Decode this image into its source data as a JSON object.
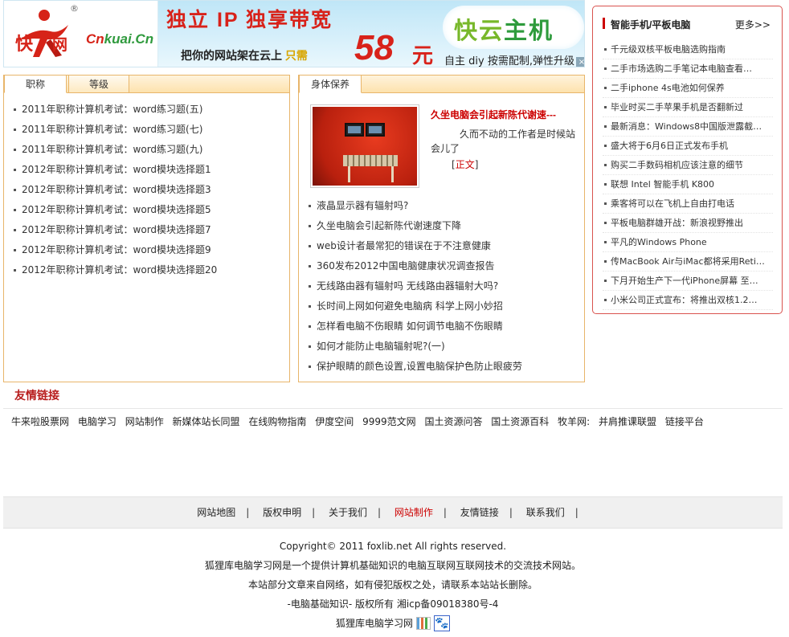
{
  "banner": {
    "logo_text_red": "Cn",
    "logo_text_green": "kuai.Cn",
    "logo_char1": "快",
    "logo_char2": "网",
    "reg": "®",
    "headline": "独立 IP  独享带宽",
    "slogan_prefix": "把你的网站架在云上",
    "slogan_only": "只需",
    "price": "58",
    "unit": "元",
    "sub": "自主 diy 按需配制,弹性升级",
    "brand_a": "快云",
    "brand_b": "主机",
    "close": "×"
  },
  "left_box": {
    "tabs": [
      "职称",
      "等级"
    ],
    "items": [
      "2011年职称计算机考试：word练习题(五)",
      "2011年职称计算机考试：word练习题(七)",
      "2011年职称计算机考试：word练习题(九)",
      "2012年职称计算机考试：word模块选择题1",
      "2012年职称计算机考试：word模块选择题3",
      "2012年职称计算机考试：word模块选择题5",
      "2012年职称计算机考试：word模块选择题7",
      "2012年职称计算机考试：word模块选择题9",
      "2012年职称计算机考试：word模块选择题20"
    ]
  },
  "mid_box": {
    "tab": "身体保养",
    "featured": {
      "title": "久坐电脑会引起新陈代谢速---",
      "desc": "久而不动的工作者是时候站会儿了",
      "more_open": "[",
      "more_label": "正文",
      "more_close": "]"
    },
    "items": [
      "液晶显示器有辐射吗?",
      "久坐电脑会引起新陈代谢速度下降",
      "web设计者最常犯的错误在于不注意健康",
      "360发布2012中国电脑健康状况调查报告",
      "无线路由器有辐射吗 无线路由器辐射大吗?",
      "长时间上网如何避免电脑病 科学上网小妙招",
      "怎样看电脑不伤眼睛 如何调节电脑不伤眼睛",
      "如何才能防止电脑辐射呢?(一)",
      "保护眼睛的颜色设置,设置电脑保护色防止眼疲劳"
    ]
  },
  "sidebar": {
    "title": "智能手机/平板电脑",
    "more": "更多>>",
    "items": [
      "千元级双核平板电脑选购指南",
      "二手市场选购二手笔记本电脑查看…",
      "二手iphone 4s电池如何保养",
      "毕业时买二手苹果手机是否翻新过",
      "最新消息：Windows8中国版泄露截…",
      "盛大将于6月6日正式发布手机",
      "购买二手数码相机应该注意的细节",
      "联想 Intel 智能手机 K800",
      "乘客将可以在飞机上自由打电话",
      "平板电脑群雄开战：新浪视野推出",
      "平凡的Windows Phone",
      "传MacBook Air与iMac都将采用Reti…",
      "下月开始生产下一代iPhone屏幕 至…",
      "小米公司正式宣布：将推出双核1.2…"
    ]
  },
  "friends": {
    "title": "友情链接",
    "links": [
      "牛来啦股票网",
      "电脑学习",
      "网站制作",
      "新媒体站长同盟",
      "在线购物指南",
      "伊度空间",
      "9999范文网",
      "国土资源问答",
      "国土资源百科",
      "牧羊网:",
      "并肩推课联盟",
      "链接平台"
    ]
  },
  "footer": {
    "nav": [
      {
        "label": "网站地图",
        "active": false
      },
      {
        "label": "版权申明",
        "active": false
      },
      {
        "label": "关于我们",
        "active": false
      },
      {
        "label": "网站制作",
        "active": true
      },
      {
        "label": "友情链接",
        "active": false
      },
      {
        "label": "联系我们",
        "active": false
      }
    ],
    "separator": "|",
    "copyright": "Copyright© 2011 foxlib.net All rights reserved.",
    "about": "狐狸库电脑学习网是一个提供计算机基础知识的电脑互联网互联网技术的交流技术网站。",
    "notice": "本站部分文章来自网络，如有侵犯版权之处，请联系本站站长删除。",
    "icp": "-电脑基础知识- 版权所有   湘icp备09018380号-4",
    "site_name": "狐狸库电脑学习网",
    "baidu_glyph": "🐾"
  },
  "colors": {
    "accent_red": "#c00000",
    "tab_border": "#e8b56a",
    "sidebar_border": "#d9534f"
  }
}
